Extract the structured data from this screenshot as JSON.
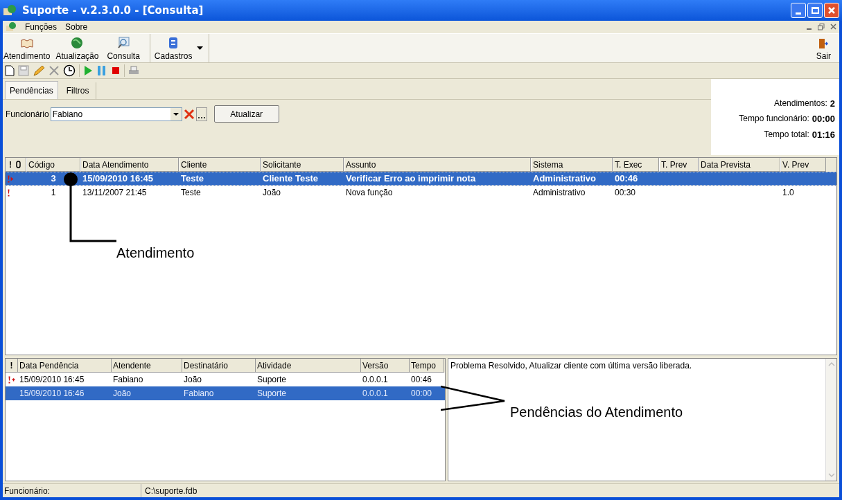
{
  "window": {
    "title": "Suporte - v.2.3.0.0 - [Consulta]"
  },
  "menu": [
    "Funções",
    "Sobre"
  ],
  "toolbar": [
    {
      "label": "Atendimento",
      "kind": "book"
    },
    {
      "label": "Atualização",
      "kind": "globe"
    },
    {
      "label": "Consulta",
      "kind": "search"
    },
    {
      "label": "Cadastros",
      "kind": "db"
    }
  ],
  "exit": {
    "label": "Sair"
  },
  "tabs": [
    {
      "label": "Pendências",
      "selected": true
    },
    {
      "label": "Filtros",
      "selected": false
    }
  ],
  "filter": {
    "label": "Funcionário",
    "value": "Fabiano",
    "button": "Atualizar"
  },
  "summary": [
    {
      "label": "Atendimentos:",
      "value": "2"
    },
    {
      "label": "Tempo funcionário:",
      "value": "00:00"
    },
    {
      "label": "Tempo total:",
      "value": "01:16"
    }
  ],
  "table": {
    "columns": [
      "!",
      "Código",
      "Data Atendimento",
      "Cliente",
      "Solicitante",
      "Assunto",
      "Sistema",
      "T. Exec",
      "T. Prev",
      "Data Prevista",
      "V. Prev"
    ],
    "rows": [
      {
        "selected": true,
        "kind": "flag-arrow",
        "cells": [
          "",
          "3",
          "15/09/2010 16:45",
          "Teste",
          "Cliente Teste",
          "Verificar Erro ao imprimir nota",
          "Administrativo",
          "00:46",
          "",
          "",
          ""
        ]
      },
      {
        "selected": false,
        "kind": "flag",
        "cells": [
          "",
          "1",
          "13/11/2007 21:45",
          "Teste",
          "João",
          "Nova função",
          "Administrativo",
          "00:30",
          "",
          "",
          "1.0"
        ]
      }
    ]
  },
  "pending": {
    "columns": [
      "!",
      "Data Pendência",
      "Atendente",
      "Destinatário",
      "Atividade",
      "Versão",
      "Tempo"
    ],
    "rows": [
      {
        "selected": false,
        "kind": "flag-plus",
        "cells": [
          "",
          "15/09/2010 16:45",
          "Fabiano",
          "João",
          "Suporte",
          "0.0.0.1",
          "00:46"
        ]
      },
      {
        "selected": true,
        "kind": "none",
        "cells": [
          "",
          "15/09/2010 16:46",
          "João",
          "Fabiano",
          "Suporte",
          "0.0.0.1",
          "00:00"
        ]
      }
    ]
  },
  "note": "Problema Resolvido, Atualizar cliente com última versão liberada.",
  "annotations": [
    "Atendimento",
    "Pendências do Atendimento"
  ],
  "status_bar": [
    "Funcionário:",
    "C:\\suporte.fdb"
  ]
}
